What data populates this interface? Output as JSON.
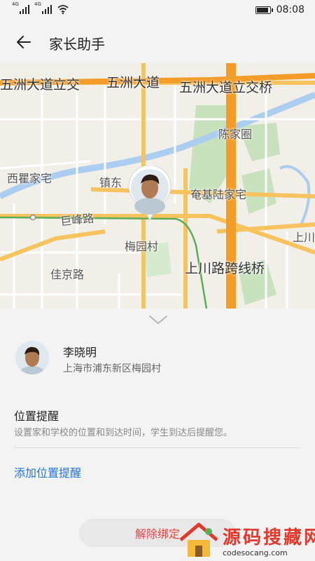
{
  "status_bar": {
    "sim1": "4G",
    "sim2": "4G",
    "time": "08:08",
    "icons": [
      "signal-icon",
      "signal-icon",
      "wifi-icon",
      "battery-icon"
    ],
    "battery_level": 0.9
  },
  "app_bar": {
    "title": "家长助手",
    "back_icon": "arrow-left-icon"
  },
  "map": {
    "labels": {
      "wz_left": "五洲大道立交",
      "wz_mid": "五洲大道",
      "wz_right": "五洲大道立交桥",
      "chenjiaquan": "陈家圈",
      "xiqujiazhai": "西瞿家宅",
      "zhendong": "镇东",
      "yanjilujiazhai": "奄基陆家宅",
      "jufenglu": "巨峰路",
      "meiyuancun": "梅园村",
      "shang_right": "上川",
      "shangchuan_bridge": "上川路跨线桥",
      "jiajinglu": "佳京路"
    },
    "colors": {
      "land": "#f2efe9",
      "park": "#c8e2bd",
      "water": "#aacdf0",
      "main_road": "#f7c35e",
      "expressway": "#f39c2a",
      "metro_line": "#5aae5a"
    }
  },
  "panel": {
    "collapse_icon": "chevron-down-icon",
    "student": {
      "name": "李晓明",
      "address": "上海市浦东新区梅园村"
    },
    "reminder": {
      "title": "位置提醒",
      "description": "设置家和学校的位置和到达时间，学生到达后提醒您。",
      "add_label": "添加位置提醒"
    },
    "unbind_label": "解除绑定"
  },
  "watermark": {
    "text": "源码搜藏网",
    "url": "codesocang.com"
  }
}
